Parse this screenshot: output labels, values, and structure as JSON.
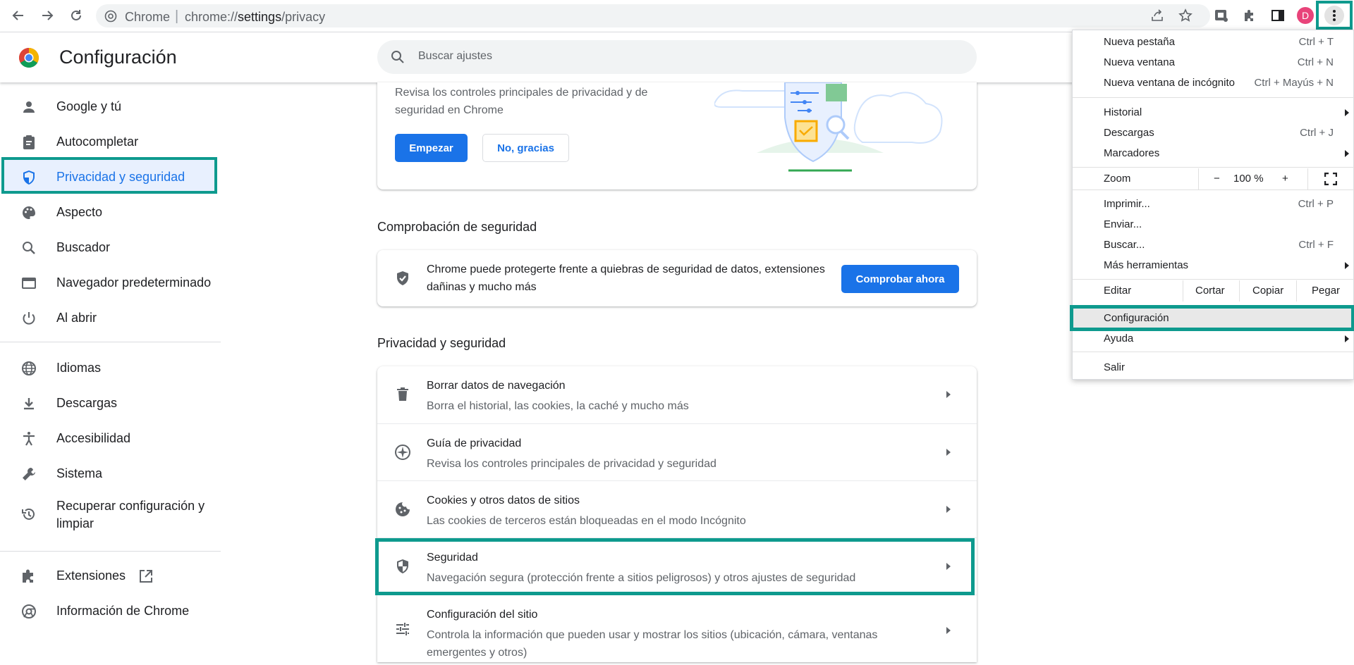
{
  "toolbar": {
    "site_label": "Chrome",
    "url_prefix": "chrome://",
    "url_main": "settings",
    "url_suffix": "/privacy",
    "avatar_letter": "D"
  },
  "header": {
    "title": "Configuración",
    "search_placeholder": "Buscar ajustes"
  },
  "sidebar": {
    "items": [
      {
        "label": "Google y tú",
        "icon": "person-icon"
      },
      {
        "label": "Autocompletar",
        "icon": "clipboard-icon"
      },
      {
        "label": "Privacidad y seguridad",
        "icon": "shield-icon",
        "active": true
      },
      {
        "label": "Aspecto",
        "icon": "palette-icon"
      },
      {
        "label": "Buscador",
        "icon": "search-icon"
      },
      {
        "label": "Navegador predeterminado",
        "icon": "browser-icon"
      },
      {
        "label": "Al abrir",
        "icon": "power-icon"
      },
      {
        "label": "Idiomas",
        "icon": "globe-icon"
      },
      {
        "label": "Descargas",
        "icon": "download-icon"
      },
      {
        "label": "Accesibilidad",
        "icon": "accessibility-icon"
      },
      {
        "label": "Sistema",
        "icon": "wrench-icon"
      },
      {
        "label": "Recuperar configuración y limpiar",
        "icon": "restore-icon"
      },
      {
        "label": "Extensiones",
        "icon": "puzzle-icon"
      },
      {
        "label": "Información de Chrome",
        "icon": "chrome-icon"
      }
    ]
  },
  "privacy_guide": {
    "text": "Revisa los controles principales de privacidad y de seguridad en Chrome",
    "start_label": "Empezar",
    "decline_label": "No, gracias"
  },
  "safety_check": {
    "heading": "Comprobación de seguridad",
    "text": "Chrome puede protegerte frente a quiebras de seguridad de datos, extensiones dañinas y mucho más",
    "button_label": "Comprobar ahora"
  },
  "privacy_section": {
    "heading": "Privacidad y seguridad",
    "rows": [
      {
        "title": "Borrar datos de navegación",
        "subtitle": "Borra el historial, las cookies, la caché y mucho más",
        "icon": "trash-icon"
      },
      {
        "title": "Guía de privacidad",
        "subtitle": "Revisa los controles principales de privacidad y seguridad",
        "icon": "compass-icon"
      },
      {
        "title": "Cookies y otros datos de sitios",
        "subtitle": "Las cookies de terceros están bloqueadas en el modo Incógnito",
        "icon": "cookie-icon"
      },
      {
        "title": "Seguridad",
        "subtitle": "Navegación segura (protección frente a sitios peligrosos) y otros ajustes de seguridad",
        "icon": "shield-icon"
      },
      {
        "title": "Configuración del sitio",
        "subtitle": "Controla la información que pueden usar y mostrar los sitios (ubicación, cámara, ventanas emergentes y otros)",
        "icon": "sliders-icon"
      }
    ]
  },
  "menu": {
    "new_tab": {
      "label": "Nueva pestaña",
      "shortcut": "Ctrl + T"
    },
    "new_window": {
      "label": "Nueva ventana",
      "shortcut": "Ctrl + N"
    },
    "incognito": {
      "label": "Nueva ventana de incógnito",
      "shortcut": "Ctrl + Mayús + N"
    },
    "history": {
      "label": "Historial"
    },
    "downloads": {
      "label": "Descargas",
      "shortcut": "Ctrl + J"
    },
    "bookmarks": {
      "label": "Marcadores"
    },
    "zoom": {
      "label": "Zoom",
      "minus": "−",
      "value": "100 %",
      "plus": "+"
    },
    "print": {
      "label": "Imprimir...",
      "shortcut": "Ctrl + P"
    },
    "cast": {
      "label": "Enviar..."
    },
    "find": {
      "label": "Buscar...",
      "shortcut": "Ctrl + F"
    },
    "more_tools": {
      "label": "Más herramientas"
    },
    "edit": {
      "label": "Editar",
      "cut": "Cortar",
      "copy": "Copiar",
      "paste": "Pegar"
    },
    "settings": {
      "label": "Configuración"
    },
    "help": {
      "label": "Ayuda"
    },
    "exit": {
      "label": "Salir"
    }
  },
  "colors": {
    "accent": "#1a73e8",
    "highlight": "#0e9a8e"
  }
}
